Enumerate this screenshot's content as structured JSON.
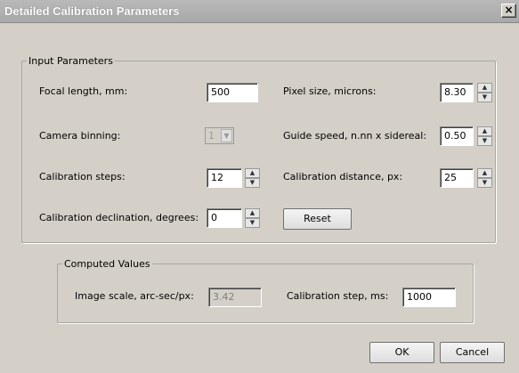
{
  "window": {
    "title": "Detailed Calibration Parameters",
    "close_glyph": "×"
  },
  "input_params": {
    "legend": "Input Parameters",
    "focal_length": {
      "label": "Focal length, mm:",
      "value": "500"
    },
    "pixel_size": {
      "label": "Pixel size, microns:",
      "value": "8.30"
    },
    "camera_binning": {
      "label": "Camera binning:",
      "value": "1"
    },
    "guide_speed": {
      "label": "Guide speed, n.nn x sidereal:",
      "value": "0.50"
    },
    "calibration_steps": {
      "label": "Calibration steps:",
      "value": "12"
    },
    "calibration_distance": {
      "label": "Calibration distance, px:",
      "value": "25"
    },
    "calibration_declination": {
      "label": "Calibration declination, degrees:",
      "value": "0"
    },
    "reset_label": "Reset"
  },
  "computed": {
    "legend": "Computed Values",
    "image_scale": {
      "label": "Image scale, arc-sec/px:",
      "value": "3.42"
    },
    "calibration_step": {
      "label": "Calibration step, ms:",
      "value": "1000"
    }
  },
  "buttons": {
    "ok": "OK",
    "cancel": "Cancel"
  },
  "spin_glyphs": {
    "up": "▲",
    "down": "▼"
  }
}
